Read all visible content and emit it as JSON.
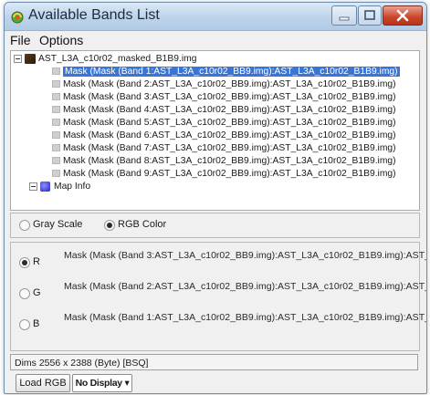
{
  "window": {
    "title": "Available Bands List",
    "accent": "#3875d7",
    "close_color": "#c9442a"
  },
  "menu": {
    "file": "File",
    "options": "Options"
  },
  "tree": {
    "root_label": "AST_L3A_c10r02_masked_B1B9.img",
    "bands": [
      "Mask (Mask (Band 1:AST_L3A_c10r02_BB9.img):AST_L3A_c10r02_B1B9.img)",
      "Mask (Mask (Band 2:AST_L3A_c10r02_BB9.img):AST_L3A_c10r02_B1B9.img)",
      "Mask (Mask (Band 3:AST_L3A_c10r02_BB9.img):AST_L3A_c10r02_B1B9.img)",
      "Mask (Mask (Band 4:AST_L3A_c10r02_BB9.img):AST_L3A_c10r02_B1B9.img)",
      "Mask (Mask (Band 5:AST_L3A_c10r02_BB9.img):AST_L3A_c10r02_B1B9.img)",
      "Mask (Mask (Band 6:AST_L3A_c10r02_BB9.img):AST_L3A_c10r02_B1B9.img)",
      "Mask (Mask (Band 7:AST_L3A_c10r02_BB9.img):AST_L3A_c10r02_B1B9.img)",
      "Mask (Mask (Band 8:AST_L3A_c10r02_BB9.img):AST_L3A_c10r02_B1B9.img)",
      "Mask (Mask (Band 9:AST_L3A_c10r02_BB9.img):AST_L3A_c10r02_B1B9.img)"
    ],
    "selected_index": 0,
    "map_info_label": "Map Info"
  },
  "mode": {
    "gray_label": "Gray Scale",
    "rgb_label": "RGB Color",
    "selected": "rgb"
  },
  "channels": {
    "r_label": "R",
    "r_value": "Mask (Mask (Band 3:AST_L3A_c10r02_BB9.img):AST_L3A_c10r02_B1B9.img):AST_",
    "g_label": "G",
    "g_value": "Mask (Mask (Band 2:AST_L3A_c10r02_BB9.img):AST_L3A_c10r02_B1B9.img):AST_",
    "b_label": "B",
    "b_value": "Mask (Mask (Band 1:AST_L3A_c10r02_BB9.img):AST_L3A_c10r02_B1B9.img):AST_",
    "selected": "R"
  },
  "dims": "Dims 2556 x 2388 (Byte) [BSQ]",
  "buttons": {
    "load": "Load RGB",
    "display": "No Display ▾"
  }
}
